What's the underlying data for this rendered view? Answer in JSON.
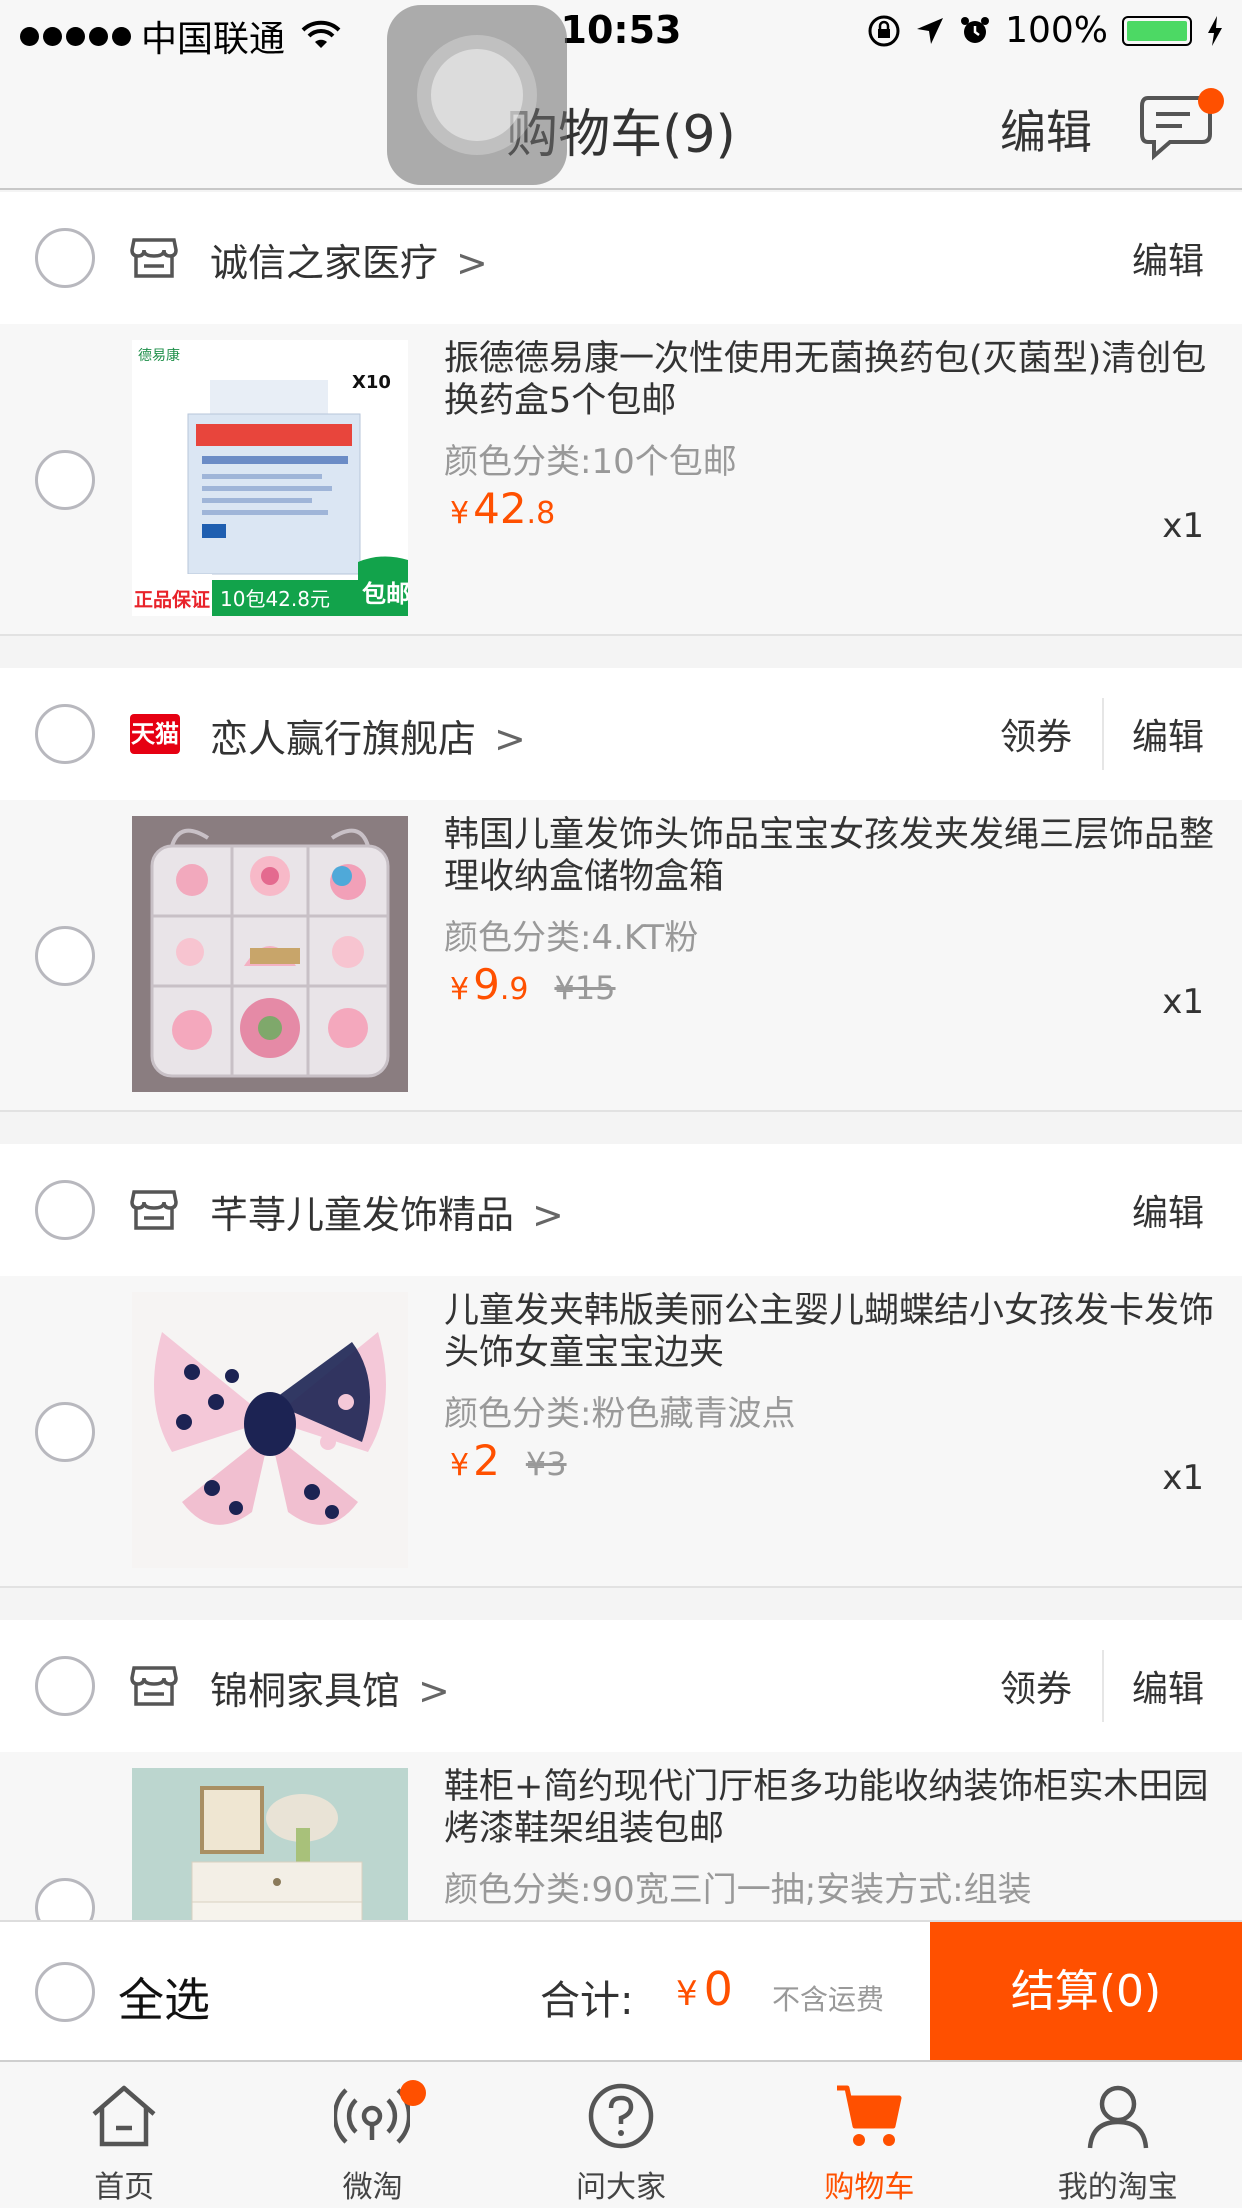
{
  "status_bar": {
    "carrier": "中国联通",
    "time": "10:53",
    "battery": "100%",
    "signal_dots": 5
  },
  "nav": {
    "title": "购物车(9)",
    "edit": "编辑",
    "message_icon": "chat-bubble-icon"
  },
  "shops": [
    {
      "name": "诚信之家医疗",
      "icon": "store-icon",
      "coupon": "",
      "edit": "编辑",
      "item": {
        "title": "振德德易康一次性使用无菌换药包(灭菌型)清创包换药盒5个包邮",
        "spec": "颜色分类:10个包邮",
        "price_yen": "¥",
        "price_int": "42",
        "price_dec": ".8",
        "orig_price": "",
        "qty": "x1",
        "image_text_brand": "德易康",
        "image_text_count": "X10",
        "image_text_promo": "正品保证",
        "image_text_deal": "10包42.8元",
        "image_text_free": "包邮"
      }
    },
    {
      "name": "恋人赢行旗舰店",
      "icon": "tmall-icon",
      "icon_text": "天猫",
      "coupon": "领券",
      "edit": "编辑",
      "item": {
        "title": "韩国儿童发饰头饰品宝宝女孩发夹发绳三层饰品整理收纳盒储物盒箱",
        "spec": "颜色分类:4.KT粉",
        "price_yen": "¥",
        "price_int": "9",
        "price_dec": ".9",
        "orig_price": "¥15",
        "qty": "x1"
      }
    },
    {
      "name": "芊荨儿童发饰精品",
      "icon": "store-icon",
      "coupon": "",
      "edit": "编辑",
      "item": {
        "title": "儿童发夹韩版美丽公主婴儿蝴蝶结小女孩发卡发饰头饰女童宝宝边夹",
        "spec": "颜色分类:粉色藏青波点",
        "price_yen": "¥",
        "price_int": "2",
        "price_dec": "",
        "orig_price": "¥3",
        "qty": "x1"
      }
    },
    {
      "name": "锦桐家具馆",
      "icon": "store-icon",
      "coupon": "领券",
      "edit": "编辑",
      "item": {
        "title": "鞋柜+简约现代门厅柜多功能收纳装饰柜实木田园烤漆鞋架组装包邮",
        "spec": "颜色分类:90宽三门一抽;安装方式:组装",
        "price_yen": "",
        "price_int": "",
        "price_dec": "",
        "orig_price": "",
        "qty": ""
      }
    }
  ],
  "footer": {
    "select_all": "全选",
    "total_label": "合计:",
    "total_yen": "¥",
    "total_value": "0",
    "shipping_note": "不含运费",
    "checkout": "结算(0)"
  },
  "tabs": [
    {
      "label": "首页",
      "icon": "home-icon",
      "active": false
    },
    {
      "label": "微淘",
      "icon": "broadcast-icon",
      "active": false,
      "badge": true
    },
    {
      "label": "问大家",
      "icon": "question-icon",
      "active": false
    },
    {
      "label": "购物车",
      "icon": "cart-icon",
      "active": true
    },
    {
      "label": "我的淘宝",
      "icon": "user-icon",
      "active": false
    }
  ],
  "colors": {
    "accent": "#ff5000",
    "tmall_red": "#e60012",
    "battery_green": "#4cd964"
  }
}
